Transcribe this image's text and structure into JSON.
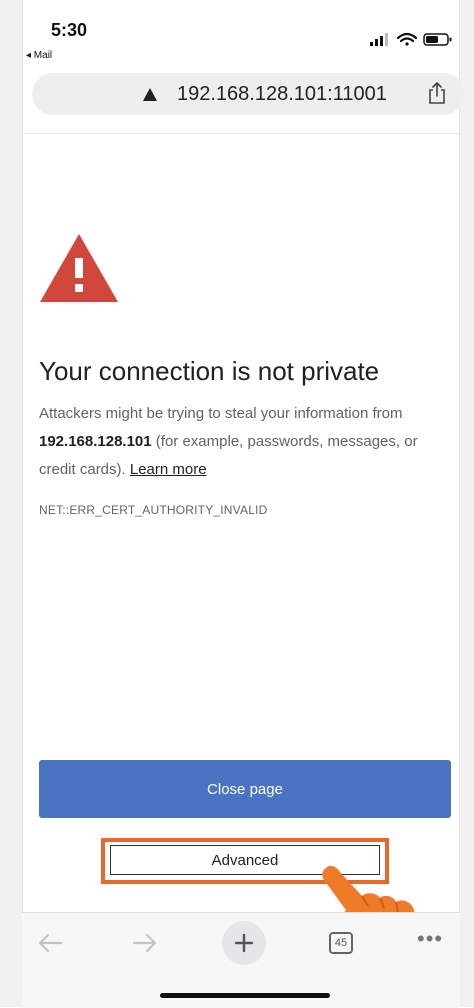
{
  "status_bar": {
    "time": "5:30",
    "back_app": "◂ Mail"
  },
  "address_bar": {
    "url": "192.168.128.101:11001",
    "lock_icon": "warning-triangle-icon",
    "share_icon": "share-icon"
  },
  "content": {
    "title": "Your connection is not private",
    "paragraph_start": "Attackers might be trying to steal your information from ",
    "paragraph_host": "192.168.128.101",
    "paragraph_mid": " (for example, passwords, messages, or credit cards). ",
    "learn_more": "Learn more",
    "error_code": "NET::ERR_CERT_AUTHORITY_INVALID",
    "close_button": "Close page",
    "advanced_button": "Advanced"
  },
  "toolbar": {
    "tab_count": "45",
    "new_tab_symbol": "+",
    "more_symbol": "•••"
  },
  "colors": {
    "warning_red": "#d1473b",
    "button_blue": "#4a73c1",
    "highlight_orange": "#e8692a"
  }
}
